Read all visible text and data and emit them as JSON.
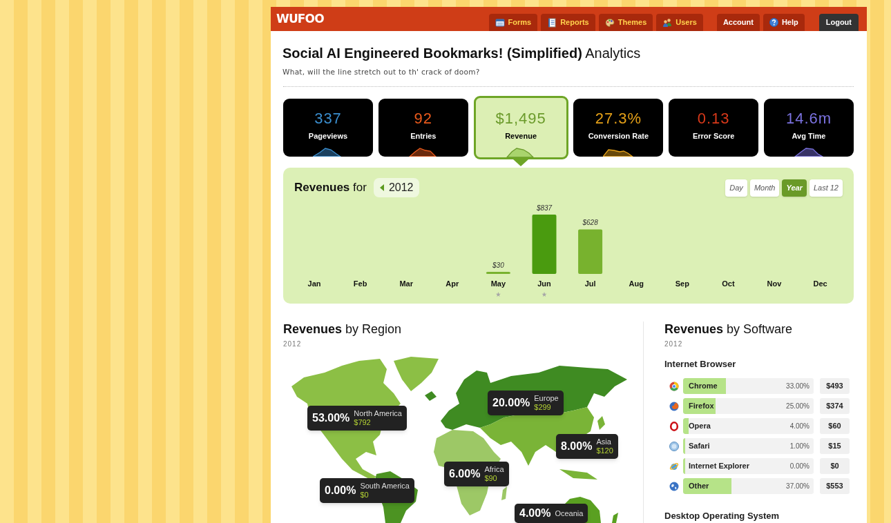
{
  "header": {
    "logo": "WUFOO",
    "tabs": [
      {
        "label": "Forms"
      },
      {
        "label": "Reports"
      },
      {
        "label": "Themes"
      },
      {
        "label": "Users"
      }
    ],
    "account_links": [
      {
        "label": "Account"
      },
      {
        "label": "Help"
      }
    ],
    "logout": "Logout"
  },
  "page": {
    "title": "**Social AI Engineered Bookmarks! (Simplified)** Analytics",
    "subtitle": "What, will the line stretch out to th' crack of doom?"
  },
  "stats": [
    {
      "value": "337",
      "label": "Pageviews",
      "color": "#3b8fd0",
      "selected": false
    },
    {
      "value": "92",
      "label": "Entries",
      "color": "#ea5a1c",
      "selected": false
    },
    {
      "value": "$1,495",
      "label": "Revenue",
      "color": "#6b9b2b",
      "selected": true
    },
    {
      "value": "27.3%",
      "label": "Conversion Rate",
      "color": "#e6a118",
      "selected": false
    },
    {
      "value": "0.13",
      "label": "Error Score",
      "color": "#d9391a",
      "selected": false
    },
    {
      "value": "14.6m",
      "label": "Avg Time",
      "color": "#7b72e0",
      "selected": false
    }
  ],
  "revenue_chart": {
    "title": "**Revenues** for",
    "year": "2012",
    "periods": [
      {
        "label": "Day",
        "selected": false
      },
      {
        "label": "Month",
        "selected": false
      },
      {
        "label": "Year",
        "selected": true
      },
      {
        "label": "Last 12",
        "selected": false
      }
    ],
    "chart_data": {
      "type": "bar",
      "categories": [
        "Jan",
        "Feb",
        "Mar",
        "Apr",
        "May",
        "Jun",
        "Jul",
        "Aug",
        "Sep",
        "Oct",
        "Nov",
        "Dec"
      ],
      "values": [
        null,
        null,
        null,
        null,
        30,
        837,
        628,
        null,
        null,
        null,
        null,
        null
      ],
      "value_labels": [
        null,
        null,
        null,
        null,
        "$30",
        "$837",
        "$628",
        null,
        null,
        null,
        null,
        null
      ]
    },
    "month_markers": [
      {
        "starred": false
      },
      {
        "starred": false
      },
      {
        "starred": false
      },
      {
        "starred": false
      },
      {
        "starred": true
      },
      {
        "starred": true
      },
      {
        "starred": false
      },
      {
        "starred": false
      },
      {
        "starred": false
      },
      {
        "starred": false
      },
      {
        "starred": false
      },
      {
        "starred": false
      }
    ]
  },
  "region_panel": {
    "title": "**Revenues** by Region",
    "subtitle": "2012",
    "regions": [
      {
        "name": "North America",
        "percent": "53.00%",
        "amount": "$792",
        "color": "#8cbf45"
      },
      {
        "name": "Europe",
        "percent": "20.00%",
        "amount": "$299",
        "color": "#3f8b22"
      },
      {
        "name": "Asia",
        "percent": "8.00%",
        "amount": "$120",
        "color": "#7ab437"
      },
      {
        "name": "Africa",
        "percent": "6.00%",
        "amount": "$90",
        "color": "#9dc866"
      },
      {
        "name": "South America",
        "percent": "0.00%",
        "amount": "$0",
        "color": "#4c9322"
      },
      {
        "name": "Oceania",
        "percent": "4.00%",
        "color": "#5aa021"
      }
    ]
  },
  "software_panel": {
    "title": "**Revenues** by Software",
    "subtitle": "2012",
    "groups": [
      {
        "heading": "Internet Browser",
        "rows": [
          {
            "name": "Chrome",
            "percent": "33.00%",
            "amount": "$493",
            "level": 0.33
          },
          {
            "name": "Firefox",
            "percent": "25.00%",
            "amount": "$374",
            "level": 0.25
          },
          {
            "name": "Opera",
            "percent": "4.00%",
            "amount": "$60",
            "level": 0.04
          },
          {
            "name": "Safari",
            "percent": "1.00%",
            "amount": "$15",
            "level": 0.01
          },
          {
            "name": "Internet Explorer",
            "percent": "0.00%",
            "amount": "$0",
            "level": 0
          },
          {
            "name": "Other",
            "percent": "37.00%",
            "amount": "$553",
            "level": 0.37
          }
        ]
      },
      {
        "heading": "Desktop Operating System"
      }
    ]
  }
}
